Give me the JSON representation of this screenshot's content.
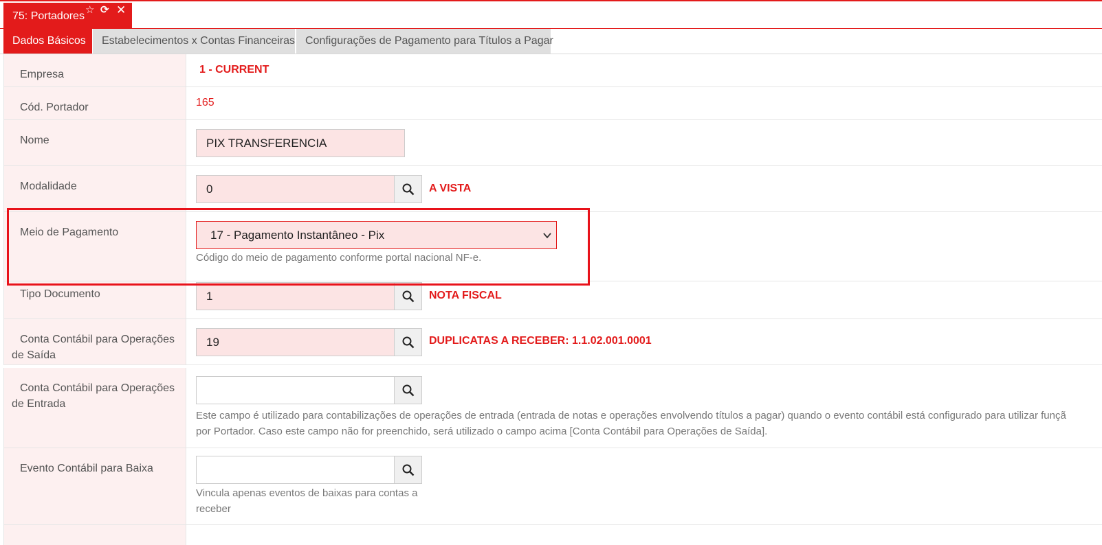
{
  "window": {
    "title": "75: Portadores",
    "icons": [
      "star-icon",
      "refresh-icon",
      "close-icon"
    ]
  },
  "tabs": [
    {
      "label": "Dados Básicos",
      "active": true
    },
    {
      "label": "Estabelecimentos x Contas Financeiras",
      "active": false
    },
    {
      "label": "Configurações de Pagamento para Títulos a Pagar",
      "active": false
    }
  ],
  "form": {
    "empresa": {
      "label": "Empresa",
      "value": "1 - CURRENT"
    },
    "cod_portador": {
      "label": "Cód. Portador",
      "value": "165"
    },
    "nome": {
      "label": "Nome",
      "value": "PIX TRANSFERENCIA"
    },
    "modalidade": {
      "label": "Modalidade",
      "value": "0",
      "description": "A VISTA"
    },
    "meio_pagamento": {
      "label": "Meio de Pagamento",
      "selected": "17 - Pagamento Instantâneo - Pix",
      "help": "Código do meio de pagamento conforme portal nacional NF-e."
    },
    "tipo_documento": {
      "label": "Tipo Documento",
      "value": "1",
      "description": "NOTA FISCAL"
    },
    "conta_saida": {
      "label": "Conta Contábil para Operações de Saída",
      "value": "19",
      "description": "DUPLICATAS A RECEBER: 1.1.02.001.0001"
    },
    "conta_entrada": {
      "label": "Conta Contábil para Operações de Entrada",
      "value": "",
      "help_line1": "Este campo é utilizado para contabilizações de operações de entrada (entrada de notas e operações envolvendo títulos a pagar) quando o evento contábil está configurado para utilizar funçã",
      "help_line2": "por Portador. Caso este campo não for preenchido, será utilizado o campo acima [Conta Contábil para Operações de Saída]."
    },
    "evento_baixa": {
      "label": "Evento Contábil para Baixa",
      "value": "",
      "help": "Vincula apenas eventos de baixas para contas a receber"
    }
  },
  "colors": {
    "accent": "#e31b1b",
    "label_bg": "#fdf0f0",
    "input_bg": "#fce4e4",
    "highlight": "#e8121a"
  }
}
